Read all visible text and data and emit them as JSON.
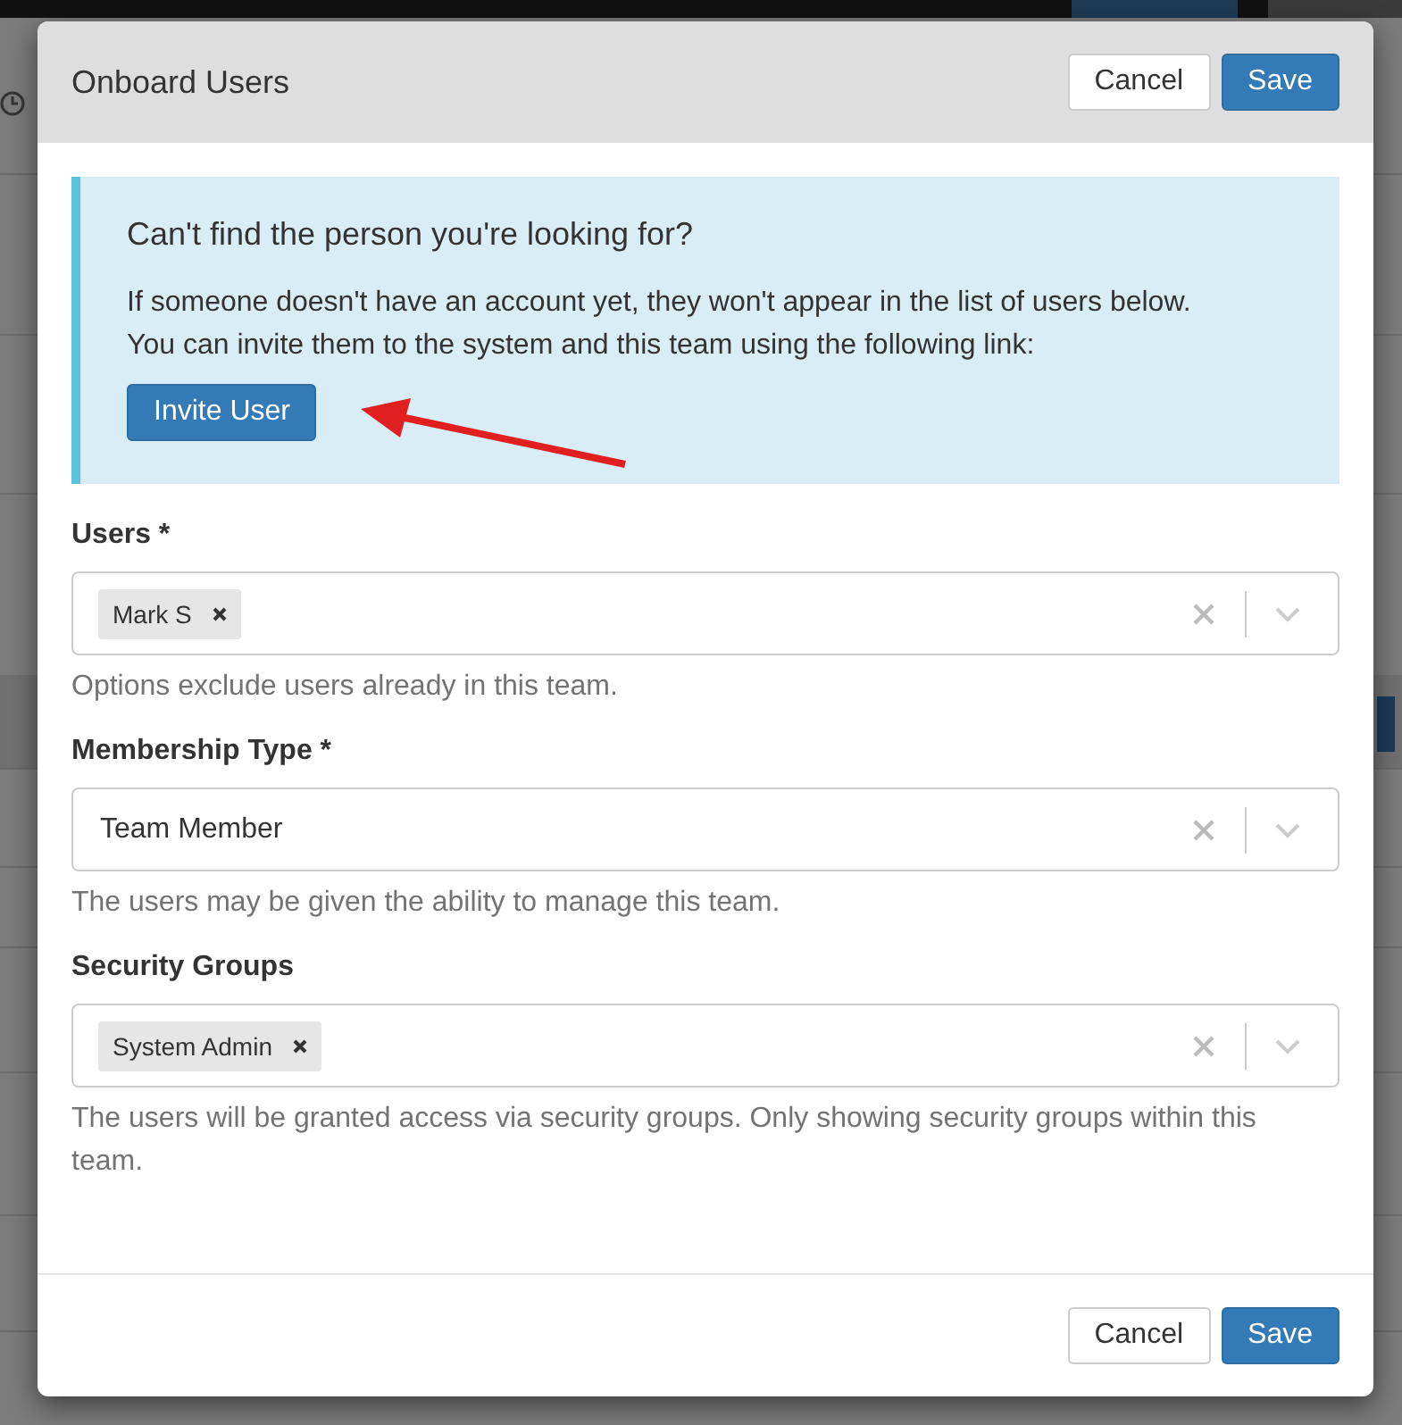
{
  "dialog": {
    "title": "Onboard Users",
    "header_buttons": [
      {
        "label": "Cancel",
        "kind": "default"
      },
      {
        "label": "Save",
        "kind": "primary"
      }
    ],
    "notice": {
      "heading": "Can't find the person you're looking for?",
      "text": "If someone doesn't have an account yet, they won't appear in the list of users below. You can invite them to the system and this team using the following link:",
      "button": "Invite User"
    },
    "fields": [
      {
        "label": "Users *",
        "chips": [
          "Mark S"
        ],
        "help": "Options exclude users already in this team."
      },
      {
        "label": "Membership Type *",
        "value": "Team Member",
        "help": "The users may be given the ability to manage this team."
      },
      {
        "label": "Security Groups",
        "chips": [
          "System Admin"
        ],
        "help": "The users will be granted access via security groups. Only showing security groups within this team."
      }
    ],
    "footer_buttons": [
      {
        "label": "Cancel",
        "kind": "default"
      },
      {
        "label": "Save",
        "kind": "primary"
      }
    ]
  }
}
